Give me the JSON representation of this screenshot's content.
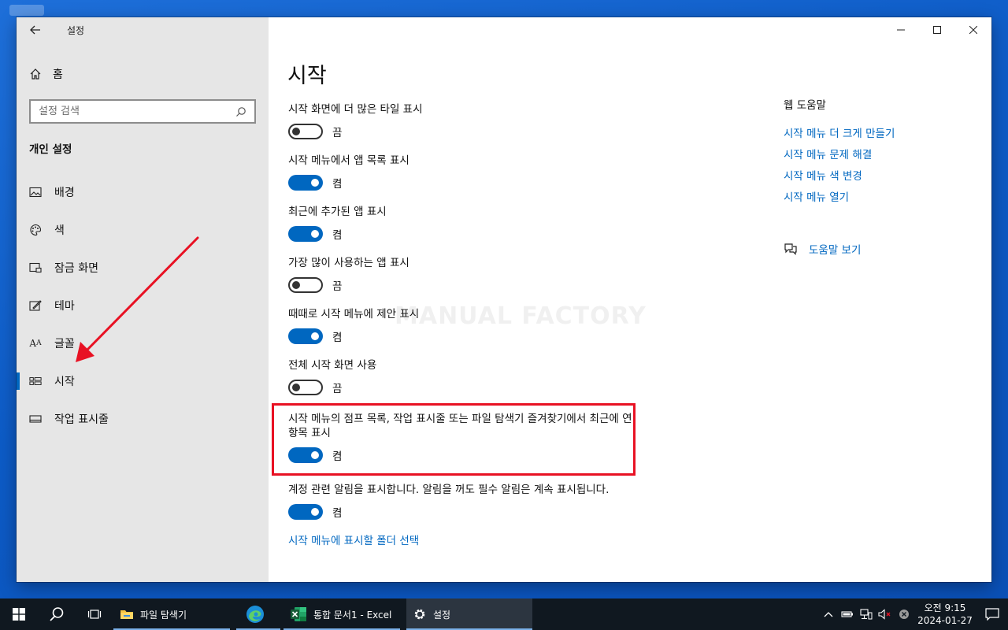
{
  "window": {
    "title": "설정",
    "caption": {
      "minimize": "—",
      "maximize": "☐",
      "close": "✕"
    }
  },
  "sidebar": {
    "home": "홈",
    "search_placeholder": "설정 검색",
    "section": "개인 설정",
    "items": [
      {
        "label": "배경",
        "icon": "picture-icon"
      },
      {
        "label": "색",
        "icon": "palette-icon"
      },
      {
        "label": "잠금 화면",
        "icon": "lock-screen-icon"
      },
      {
        "label": "테마",
        "icon": "theme-icon"
      },
      {
        "label": "글꼴",
        "icon": "font-icon"
      },
      {
        "label": "시작",
        "icon": "start-icon"
      },
      {
        "label": "작업 표시줄",
        "icon": "taskbar-icon"
      }
    ],
    "active_item": "시작"
  },
  "main": {
    "title": "시작",
    "settings": [
      {
        "label": "시작 화면에 더 많은 타일 표시",
        "state": "끔"
      },
      {
        "label": "시작 메뉴에서 앱 목록 표시",
        "state": "켬"
      },
      {
        "label": "최근에 추가된 앱 표시",
        "state": "켬"
      },
      {
        "label": "가장 많이 사용하는 앱 표시",
        "state": "끔"
      },
      {
        "label": "때때로 시작 메뉴에 제안 표시",
        "state": "켬"
      },
      {
        "label": "전체 시작 화면 사용",
        "state": "끔"
      },
      {
        "label": "시작 메뉴의 점프 목록, 작업 표시줄 또는 파일 탐색기 즐겨찾기에서 최근에 연 항목 표시",
        "state": "켬"
      },
      {
        "label": "계정 관련 알림을 표시합니다. 알림을 꺼도 필수 알림은 계속 표시됩니다.",
        "state": "켬"
      }
    ],
    "folder_link": "시작 메뉴에 표시할 폴더 선택",
    "watermark": "MANUAL FACTORY"
  },
  "help": {
    "title": "웹 도움말",
    "links": [
      "시작 메뉴 더 크게 만들기",
      "시작 메뉴 문제 해결",
      "시작 메뉴 색 변경",
      "시작 메뉴 열기"
    ],
    "view_help": "도움말 보기"
  },
  "taskbar": {
    "apps": [
      {
        "label": "파일 탐색기",
        "icon": "folder-icon"
      },
      {
        "label": "",
        "icon": "edge-icon"
      },
      {
        "label": "통합 문서1 - Excel",
        "icon": "excel-icon"
      },
      {
        "label": "설정",
        "icon": "gear-icon"
      }
    ],
    "clock": {
      "time": "오전 9:15",
      "date": "2024-01-27"
    }
  },
  "colors": {
    "accent": "#0067c0",
    "highlight": "#e81123",
    "taskbar": "#101820"
  }
}
